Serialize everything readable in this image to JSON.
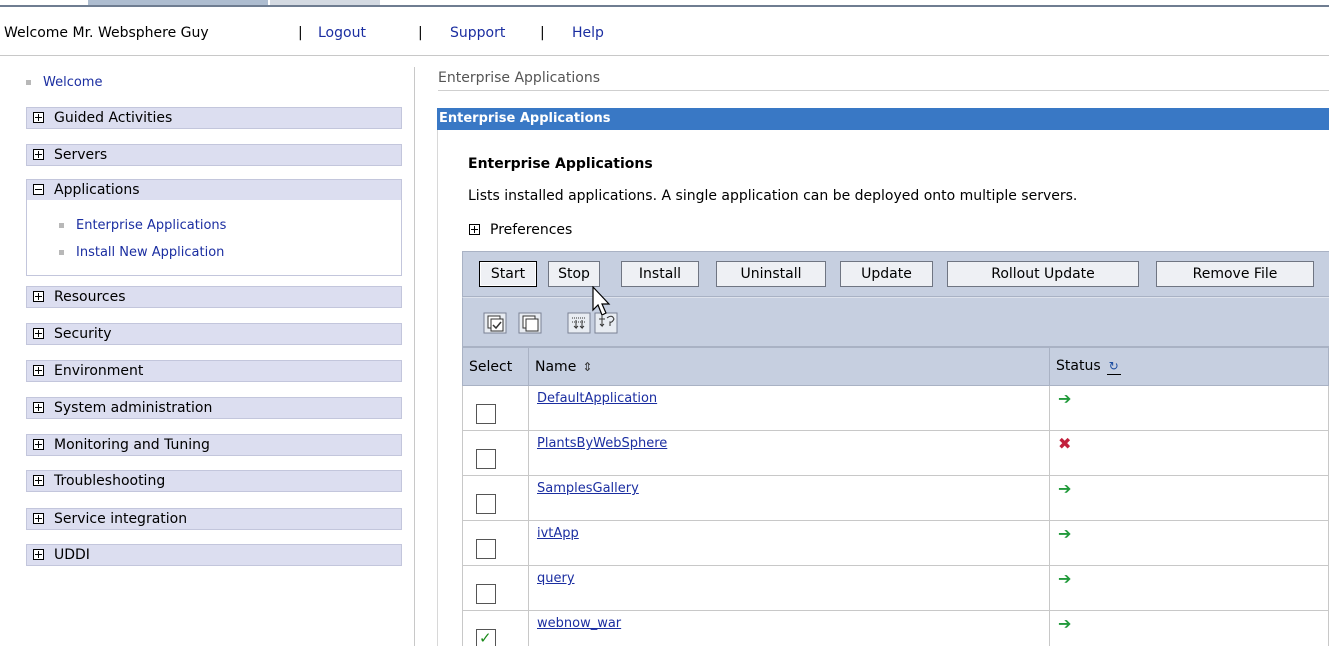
{
  "header": {
    "welcome": "Welcome Mr. Websphere Guy",
    "logout": "Logout",
    "support": "Support",
    "help": "Help"
  },
  "sidebar": {
    "welcome": "Welcome",
    "items": [
      {
        "label": "Guided Activities",
        "expanded": false
      },
      {
        "label": "Servers",
        "expanded": false
      },
      {
        "label": "Applications",
        "expanded": true
      },
      {
        "label": "Resources",
        "expanded": false
      },
      {
        "label": "Security",
        "expanded": false
      },
      {
        "label": "Environment",
        "expanded": false
      },
      {
        "label": "System administration",
        "expanded": false
      },
      {
        "label": "Monitoring and Tuning",
        "expanded": false
      },
      {
        "label": "Troubleshooting",
        "expanded": false
      },
      {
        "label": "Service integration",
        "expanded": false
      },
      {
        "label": "UDDI",
        "expanded": false
      }
    ],
    "applications_sub": [
      "Enterprise Applications",
      "Install New Application"
    ]
  },
  "main": {
    "breadcrumb": "Enterprise Applications",
    "panel_header": "Enterprise Applications",
    "title": "Enterprise Applications",
    "description": "Lists installed applications. A single application can be deployed onto multiple servers.",
    "preferences": "Preferences",
    "buttons": [
      "Start",
      "Stop",
      "Install",
      "Uninstall",
      "Update",
      "Rollout Update",
      "Remove File"
    ],
    "toolbar_icons": [
      "select-all-icon",
      "deselect-all-icon",
      "expand-filter-icon",
      "filter-icon"
    ],
    "table": {
      "columns": [
        "Select",
        "Name",
        "Status"
      ],
      "rows": [
        {
          "name": "DefaultApplication",
          "status": "started",
          "checked": false
        },
        {
          "name": "PlantsByWebSphere",
          "status": "stopped",
          "checked": false
        },
        {
          "name": "SamplesGallery",
          "status": "started",
          "checked": false
        },
        {
          "name": "ivtApp",
          "status": "started",
          "checked": false
        },
        {
          "name": "query",
          "status": "started",
          "checked": false
        },
        {
          "name": "webnow_war",
          "status": "started",
          "checked": true
        }
      ]
    }
  },
  "colors": {
    "panel_header": "#3978c5",
    "nav_bg": "#dcdef0",
    "toolbar_bg": "#c6cfe0",
    "link": "#1b2ea1",
    "status_started": "#219a3b",
    "status_stopped": "#c2213d"
  }
}
